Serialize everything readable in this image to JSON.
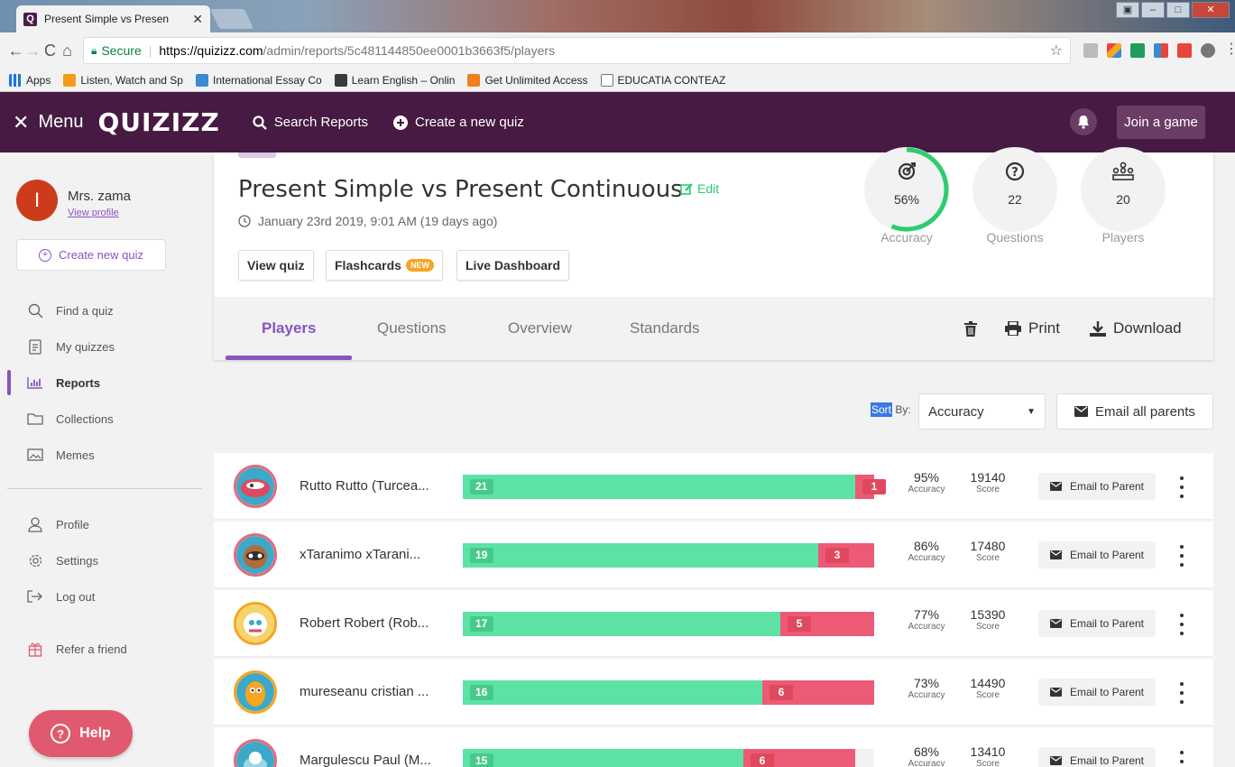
{
  "browser": {
    "tab_title": "Present Simple vs Presen",
    "tab_close": "✕",
    "url_secure": "Secure",
    "url_host": "https://quizizz.com",
    "url_path": "/admin/reports/5c481144850ee0001b3663f5/players",
    "bookmarks": [
      {
        "label": "Apps",
        "color": "#e8453c"
      },
      {
        "label": "Listen, Watch and Sp",
        "color": "#f59c1a"
      },
      {
        "label": "International Essay Co",
        "color": "#3a8bd1"
      },
      {
        "label": "Learn English – Onlin",
        "color": "#3a3a3a"
      },
      {
        "label": "Get Unlimited Access",
        "color": "#f07f1e"
      },
      {
        "label": "EDUCATIA CONTEAZ",
        "color": "#ffffff"
      }
    ]
  },
  "topbar": {
    "menu_label": "Menu",
    "logo": "QUIZIZZ",
    "search_label": "Search Reports",
    "create_label": "Create a new quiz",
    "join_label": "Join a game"
  },
  "sidebar": {
    "avatar_initial": "I",
    "user_name": "Mrs. zama",
    "view_profile": "View profile",
    "create_quiz": "Create new quiz",
    "nav": [
      {
        "label": "Find a quiz",
        "icon": "search-icon"
      },
      {
        "label": "My quizzes",
        "icon": "document-icon"
      },
      {
        "label": "Reports",
        "icon": "chart-icon"
      },
      {
        "label": "Collections",
        "icon": "folder-icon"
      },
      {
        "label": "Memes",
        "icon": "image-icon"
      }
    ],
    "nav2": [
      {
        "label": "Profile",
        "icon": "user-icon"
      },
      {
        "label": "Settings",
        "icon": "gear-icon"
      },
      {
        "label": "Log out",
        "icon": "logout-icon"
      },
      {
        "label": "Refer a friend",
        "icon": "gift-icon"
      }
    ],
    "help_label": "Help"
  },
  "report": {
    "title": "Present Simple vs Present Continuous",
    "edit_label": "Edit",
    "date": "January 23rd 2019, 9:01 AM (19 days ago)",
    "buttons": {
      "view_quiz": "View quiz",
      "flashcards": "Flashcards",
      "new_badge": "NEW",
      "live_dashboard": "Live Dashboard"
    },
    "stats": [
      {
        "value": "56%",
        "label": "Accuracy",
        "fraction": 0.56
      },
      {
        "value": "22",
        "label": "Questions"
      },
      {
        "value": "20",
        "label": "Players"
      }
    ],
    "tabs": [
      "Players",
      "Questions",
      "Overview",
      "Standards"
    ],
    "tools": {
      "print": "Print",
      "download": "Download"
    }
  },
  "sort": {
    "label_highlight": "Sort",
    "label_rest": " By:",
    "selected": "Accuracy",
    "email_all": "Email all parents"
  },
  "players": [
    {
      "name": "Rutto Rutto (Turcea...",
      "correct": 21,
      "incorrect": 1,
      "accuracy": "95%",
      "score": "19140",
      "avatar_color": "#e46a7d"
    },
    {
      "name": "xTaranimo xTarani...",
      "correct": 19,
      "incorrect": 3,
      "accuracy": "86%",
      "score": "17480",
      "avatar_color": "#e46a7d"
    },
    {
      "name": "Robert Robert (Rob...",
      "correct": 17,
      "incorrect": 5,
      "accuracy": "77%",
      "score": "15390",
      "avatar_color": "#f5a623"
    },
    {
      "name": "mureseanu cristian ...",
      "correct": 16,
      "incorrect": 6,
      "accuracy": "73%",
      "score": "14490",
      "avatar_color": "#f5a623"
    },
    {
      "name": "Margulescu Paul (M...",
      "correct": 15,
      "incorrect": 6,
      "accuracy": "68%",
      "score": "13410",
      "avatar_color": "#e46a7d"
    }
  ],
  "labels": {
    "accuracy_small": "Accuracy",
    "score_small": "Score",
    "email_parent": "Email to Parent",
    "total_questions": 22
  },
  "colors": {
    "brand": "#461a42",
    "accent": "#8854c0",
    "correct": "#5de2a5",
    "incorrect": "#ec5a75"
  }
}
